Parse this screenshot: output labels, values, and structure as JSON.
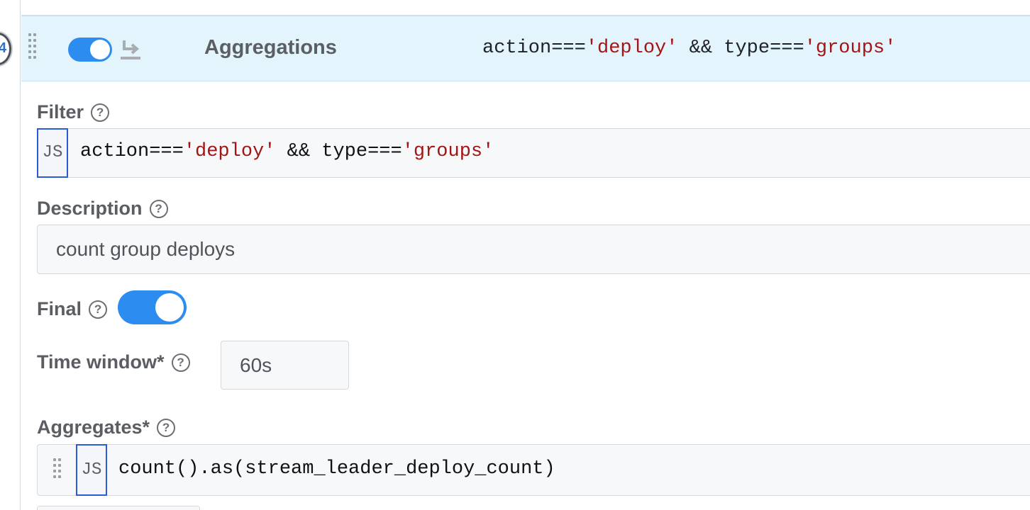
{
  "route": {
    "step_number": "4",
    "name": "Aggregations",
    "filter_prefix": "action===",
    "filter_value1": "'deploy'",
    "filter_mid": " && type===",
    "filter_value2": "'groups'",
    "enabled": true
  },
  "filter": {
    "label": "Filter",
    "lang_badge": "JS",
    "code_prefix": "action===",
    "code_value1": "'deploy'",
    "code_mid": " && type===",
    "code_value2": "'groups'"
  },
  "description": {
    "label": "Description",
    "value": "count group deploys"
  },
  "final": {
    "label": "Final",
    "enabled": true
  },
  "time_window": {
    "label": "Time window*",
    "value": "60s"
  },
  "aggregates": {
    "label": "Aggregates*",
    "lang_badge": "JS",
    "expression": "count().as(stream_leader_deploy_count)"
  },
  "icons": {
    "help": "question-circle-icon",
    "drag": "drag-handle-icon",
    "return": "return-arrow-icon"
  },
  "colors": {
    "accent": "#2d8cf0",
    "header_bg": "#e3f4fc",
    "string_literal": "#a31515",
    "js_badge_border": "#2b5bd7"
  }
}
